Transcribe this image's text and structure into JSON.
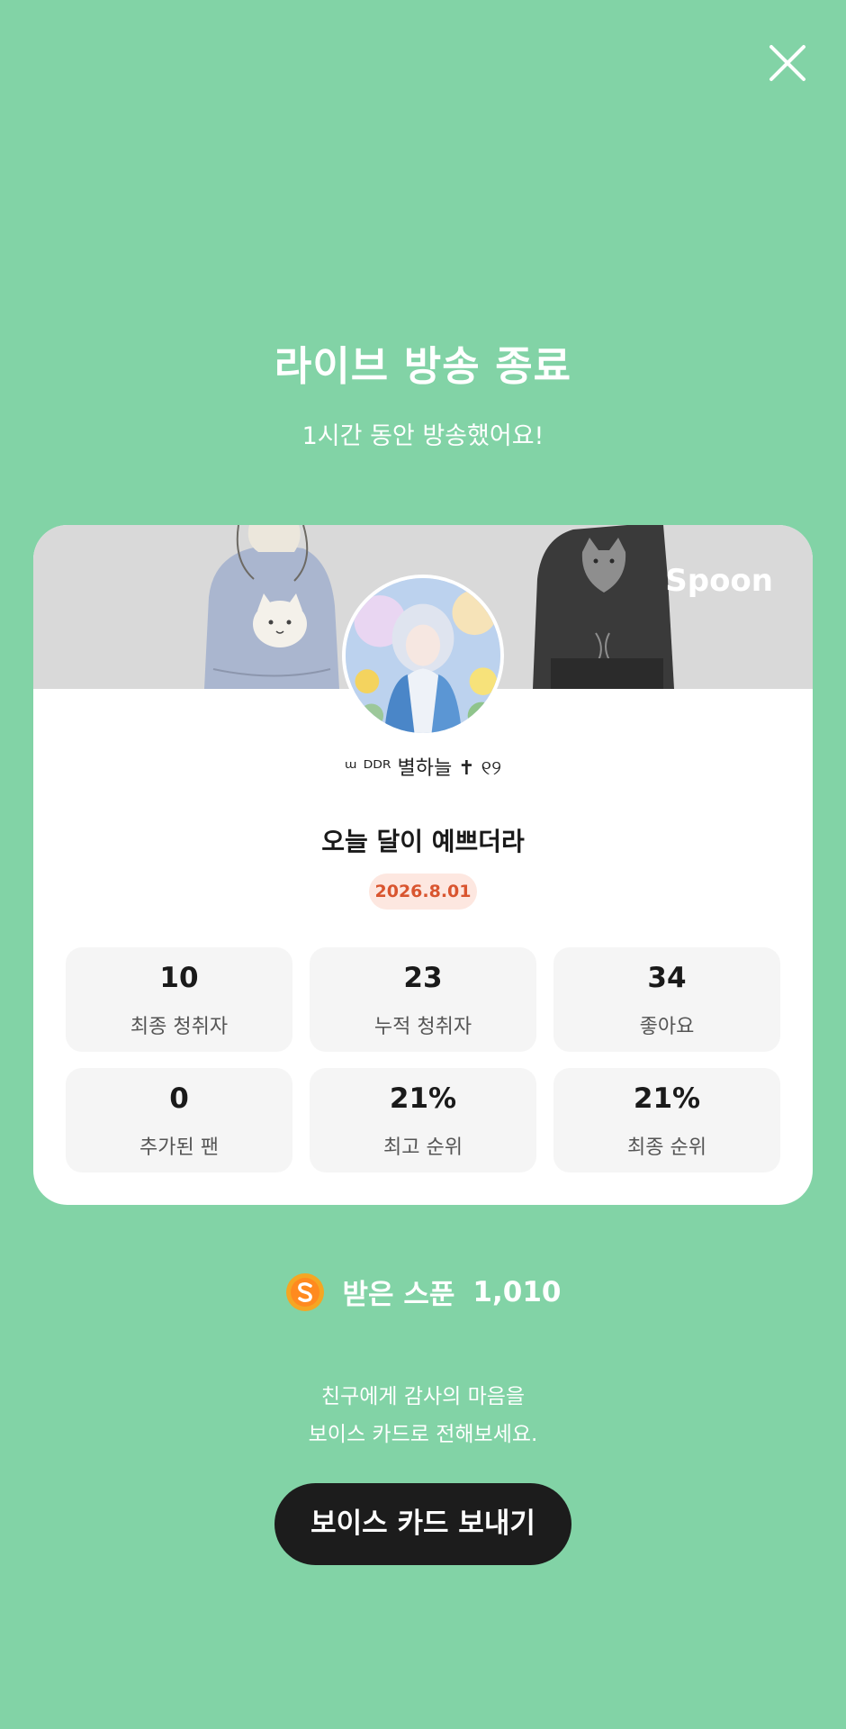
{
  "header": {
    "title": "라이브 방송 종료",
    "subtitle": "1시간 동안 방송했어요!"
  },
  "card": {
    "brand": "Spoon",
    "dj_name": "ᵚ ᴰᴰᴿ 별하늘 ✝︎ ୧୨",
    "show_title": "오늘 달이 예쁘더라",
    "date": "2026.8.01",
    "stats": [
      {
        "value": "10",
        "label": "최종 청취자"
      },
      {
        "value": "23",
        "label": "누적 청취자"
      },
      {
        "value": "34",
        "label": "좋아요"
      },
      {
        "value": "0",
        "label": "추가된 팬"
      },
      {
        "value": "21%",
        "label": "최고 순위"
      },
      {
        "value": "21%",
        "label": "최종 순위"
      }
    ]
  },
  "spoons": {
    "label": "받은 스푼",
    "value": "1,010",
    "icon": "spoon-coin-icon"
  },
  "thanks": {
    "line1": "친구에게 감사의 마음을",
    "line2": "보이스 카드로 전해보세요."
  },
  "actions": {
    "voice_card_button": "보이스 카드 보내기",
    "close_icon": "close-icon"
  },
  "colors": {
    "background": "#82d3a6",
    "button": "#1c1c1c",
    "date_badge_bg": "#fde7e0",
    "date_badge_text": "#d9552f"
  }
}
